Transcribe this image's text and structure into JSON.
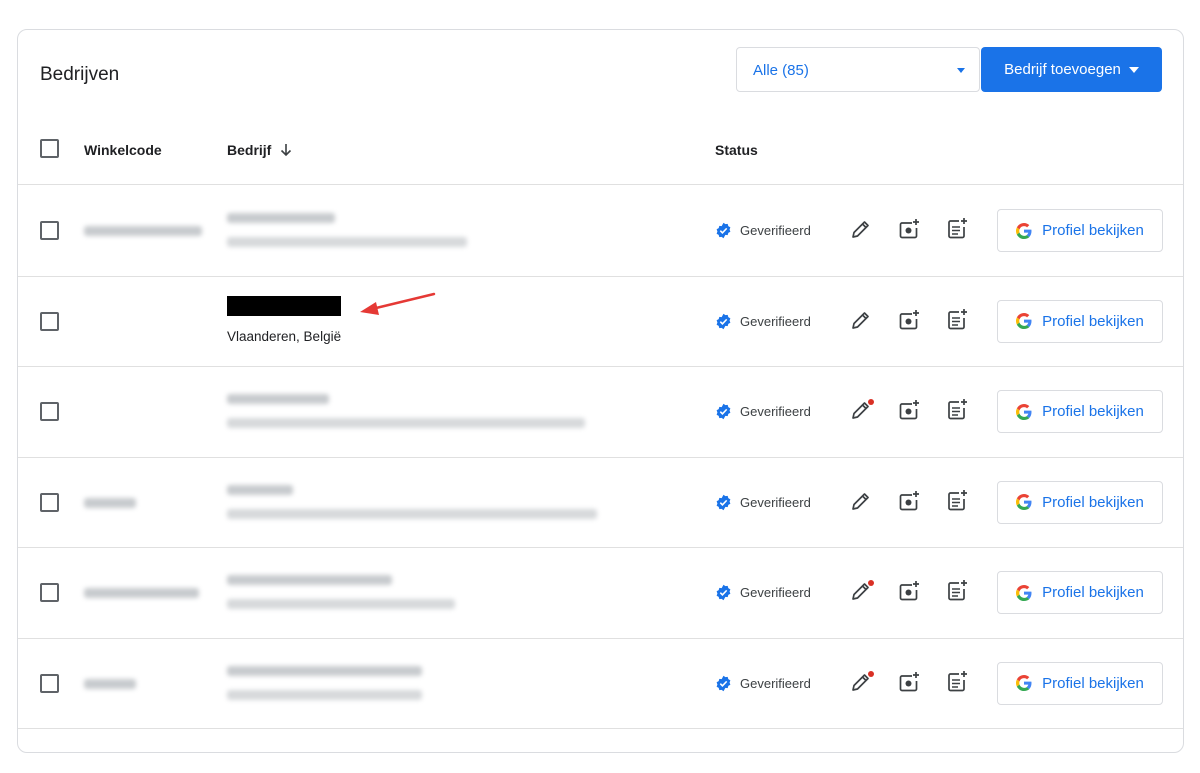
{
  "header": {
    "title": "Bedrijven",
    "filter_value": "Alle (85)",
    "add_button_label": "Bedrijf toevoegen"
  },
  "columns": {
    "code": "Winkelcode",
    "company": "Bedrijf",
    "status": "Status"
  },
  "icons": {
    "sort": "arrow-down-icon",
    "verified": "verified-badge-icon",
    "edit": "pencil-icon",
    "photo": "add-photo-icon",
    "post": "add-post-icon",
    "google": "google-g-logo"
  },
  "colors": {
    "accent": "#1a73e8",
    "notification_dot": "#d93025",
    "annotation_arrow": "#e53935"
  },
  "rows": [
    {
      "address": "",
      "status": "Geverifieerd",
      "edit_notification": false,
      "profile_label": "Profiel bekijken"
    },
    {
      "address": "Vlaanderen, België",
      "status": "Geverifieerd",
      "edit_notification": false,
      "profile_label": "Profiel bekijken"
    },
    {
      "address": "",
      "status": "Geverifieerd",
      "edit_notification": true,
      "profile_label": "Profiel bekijken"
    },
    {
      "address": "",
      "status": "Geverifieerd",
      "edit_notification": false,
      "profile_label": "Profiel bekijken"
    },
    {
      "address": "",
      "status": "Geverifieerd",
      "edit_notification": true,
      "profile_label": "Profiel bekijken"
    },
    {
      "address": "",
      "status": "Geverifieerd",
      "edit_notification": true,
      "profile_label": "Profiel bekijken"
    }
  ]
}
